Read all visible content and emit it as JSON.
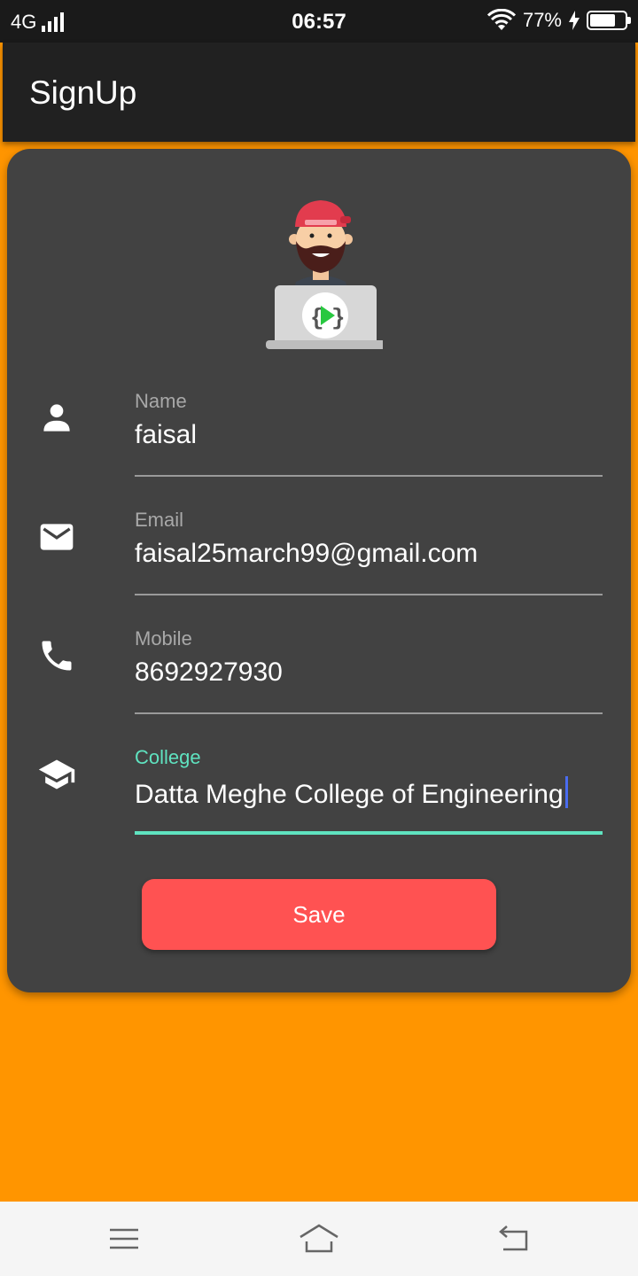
{
  "status_bar": {
    "network": "4G",
    "time": "06:57",
    "battery": "77%",
    "battery_level": 0.77
  },
  "app_bar": {
    "title": "SignUp"
  },
  "form": {
    "fields": [
      {
        "label": "Name",
        "value": "faisal",
        "icon": "person-icon"
      },
      {
        "label": "Email",
        "value": "faisal25march99@gmail.com",
        "icon": "email-icon"
      },
      {
        "label": "Mobile",
        "value": "8692927930",
        "icon": "phone-icon"
      },
      {
        "label": "College",
        "value": "Datta Meghe College of Engineering",
        "icon": "graduation-cap-icon"
      }
    ],
    "focused_field": "College",
    "save_label": "Save"
  },
  "colors": {
    "background": "#ff9500",
    "card": "#424242",
    "accent": "#5fe3c0",
    "button": "#ff5252"
  },
  "nav_bar": {
    "icons": [
      "menu-icon",
      "home-icon",
      "back-icon"
    ]
  }
}
